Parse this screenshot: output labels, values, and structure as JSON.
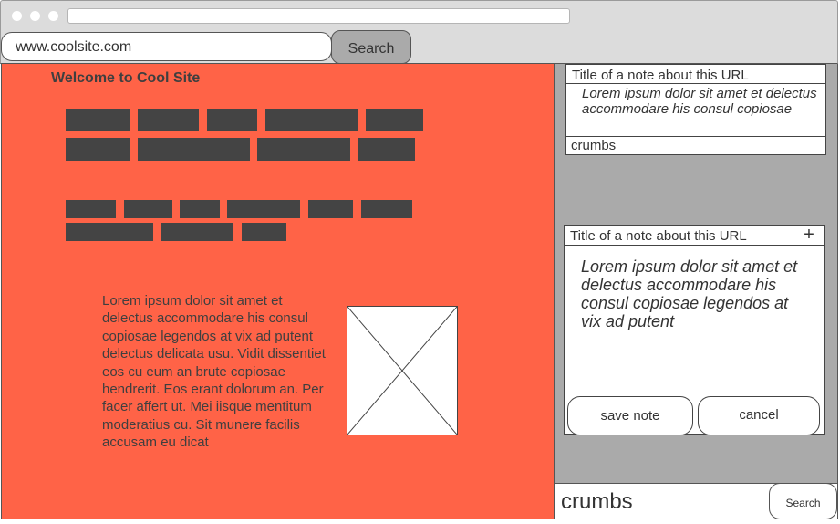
{
  "address_bar": {
    "url": "www.coolsite.com",
    "search_label": "Search"
  },
  "page": {
    "heading": "Welcome to Cool Site",
    "paragraph": "Lorem ipsum dolor sit amet et delectus accommodare his consul copiosae legendos at vix ad putent delectus delicata usu. Vidit dissentiet eos cu eum an brute copiosae hendrerit. Eos erant dolorum an. Per facer affert ut. Mei iisque mentitum moderatius cu. Sit munere facilis accusam eu dicat"
  },
  "sidebar": {
    "note1": {
      "title": "Title of a note about this URL",
      "body": "Lorem ipsum dolor sit amet et delectus accommodare his consul copiosae",
      "crumbs": "crumbs"
    },
    "note2": {
      "title": "Title of a note about this URL",
      "add_icon": "+",
      "body": "Lorem ipsum dolor sit amet et delectus accommodare his consul copiosae legendos at vix ad putent",
      "save_label": "save note",
      "cancel_label": "cancel"
    },
    "bottom": {
      "crumbs": "crumbs",
      "search_label": "Search"
    }
  }
}
